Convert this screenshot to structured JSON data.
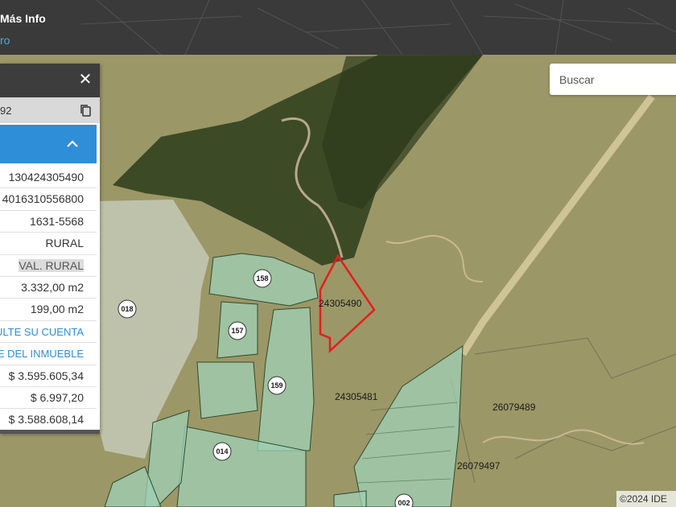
{
  "header": {
    "title": "Más Info",
    "subtitle": "ro"
  },
  "search": {
    "placeholder": "Buscar"
  },
  "panel": {
    "close_icon": "close-icon",
    "copy_icon": "copy-icon",
    "collapse_icon": "chevron-up-icon",
    "id_text": "92",
    "values": [
      "130424305490",
      "4016310556800",
      "1631-5568",
      "RURAL",
      "VAL. RURAL",
      "3.332,00 m2",
      "199,00 m2",
      "ULTE SU CUENTA",
      "E DEL INMUEBLE",
      "$ 3.595.605,34",
      "$ 6.997,20",
      "$ 3.588.608,14"
    ]
  },
  "map": {
    "parcel_labels": [
      "24305490",
      "24305481",
      "26079489",
      "26079497"
    ],
    "lot_badges": [
      "158",
      "018",
      "157",
      "159",
      "014",
      "002"
    ],
    "copyright": "©2024 IDE",
    "colors": {
      "selected_outline": "#e02020",
      "lot_fill": "#9fd0b5",
      "accent": "#2e8fd8"
    }
  }
}
